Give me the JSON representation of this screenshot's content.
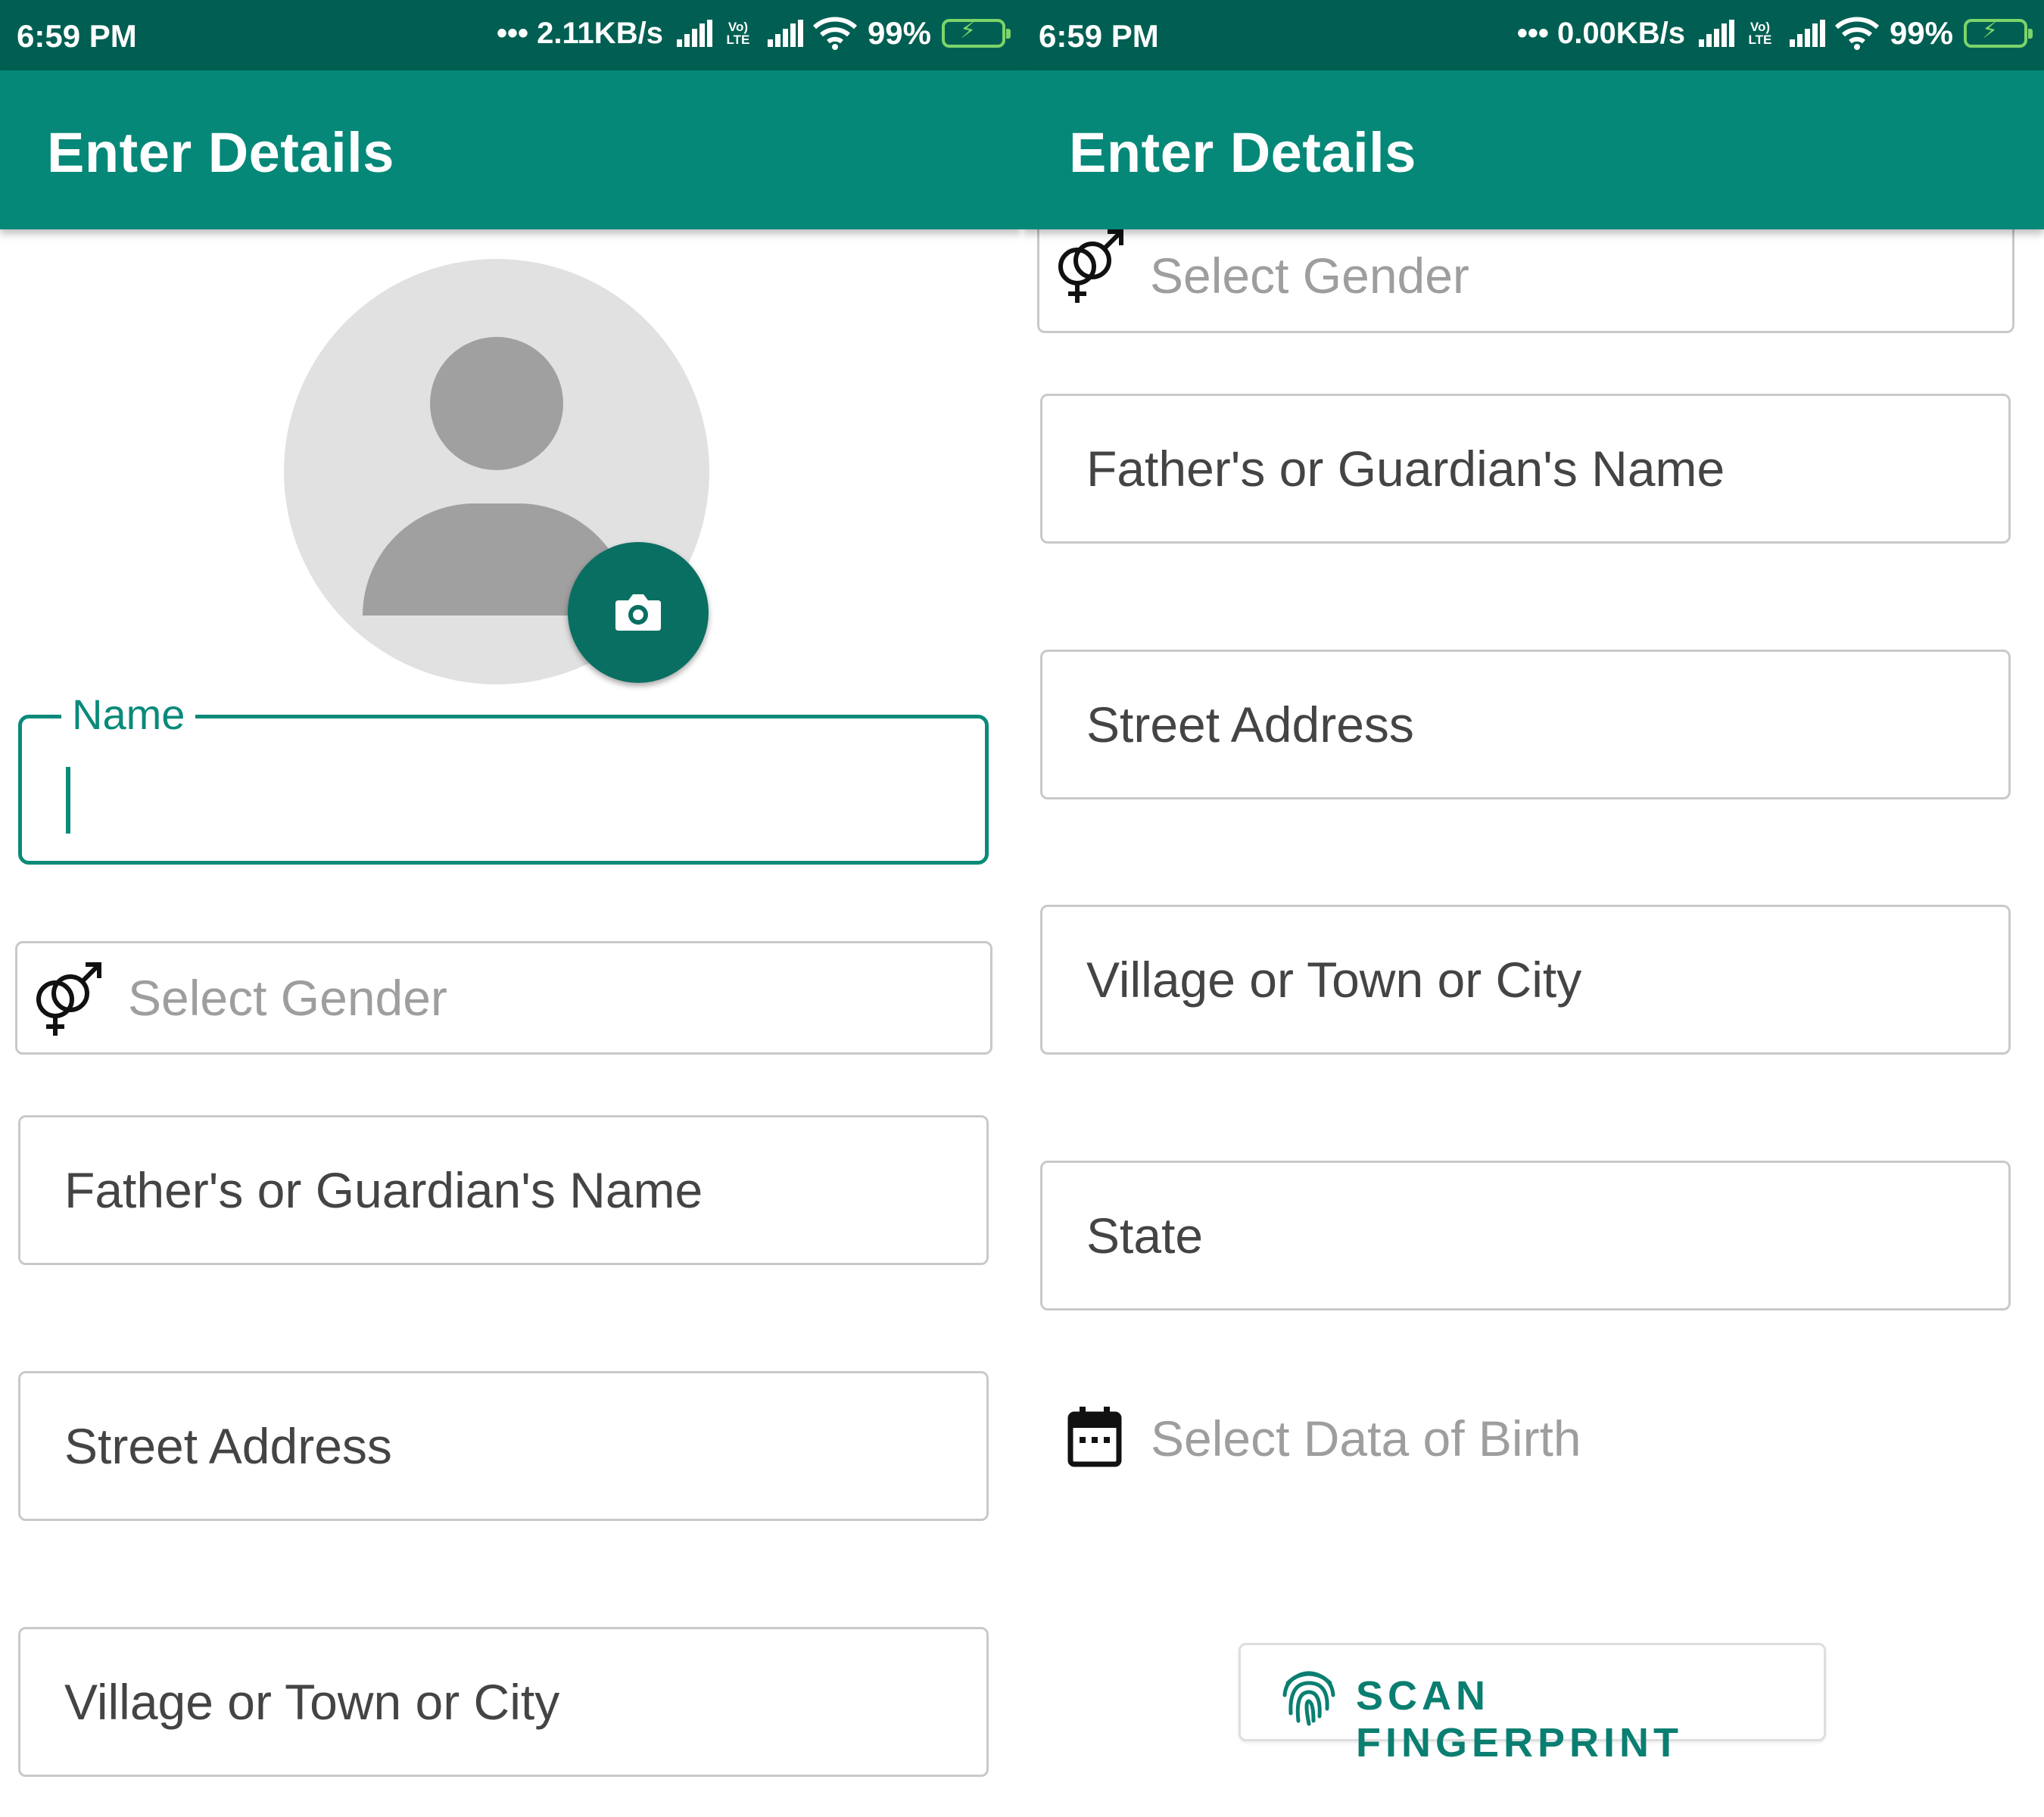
{
  "screens": [
    {
      "status_bar": {
        "time": "6:59 PM",
        "net_speed": "••• 2.11KB/s",
        "volte": "Vo)\nLTE",
        "battery": "99%"
      },
      "app_bar": {
        "title": "Enter Details"
      },
      "form": {
        "name": {
          "label": "Name",
          "value": ""
        },
        "gender": {
          "placeholder": "Select Gender"
        },
        "guardian_name": {
          "placeholder": "Father's or Guardian's Name"
        },
        "street_address": {
          "placeholder": "Street Address"
        },
        "city": {
          "placeholder": "Village or Town or City"
        }
      }
    },
    {
      "status_bar": {
        "time": "6:59 PM",
        "net_speed": "••• 0.00KB/s",
        "volte": "Vo)\nLTE",
        "battery": "99%"
      },
      "app_bar": {
        "title": "Enter Details"
      },
      "form": {
        "gender": {
          "placeholder": "Select Gender"
        },
        "guardian_name": {
          "placeholder": "Father's or Guardian's Name"
        },
        "street_address": {
          "placeholder": "Street Address"
        },
        "city": {
          "placeholder": "Village or Town or City"
        },
        "state": {
          "placeholder": "State"
        },
        "dob": {
          "placeholder": "Select Data of Birth"
        },
        "scan_button": {
          "label": "SCAN FINGERPRINT"
        }
      }
    }
  ],
  "theme": {
    "primary": "#058878",
    "primary_dark": "#005f52",
    "accent": "#0a8a7a",
    "battery": "#7cd46a"
  },
  "icons": [
    "gender-icon",
    "camera-icon",
    "calendar-icon",
    "fingerprint-icon",
    "wifi-icon",
    "signal-icon",
    "battery-icon"
  ]
}
